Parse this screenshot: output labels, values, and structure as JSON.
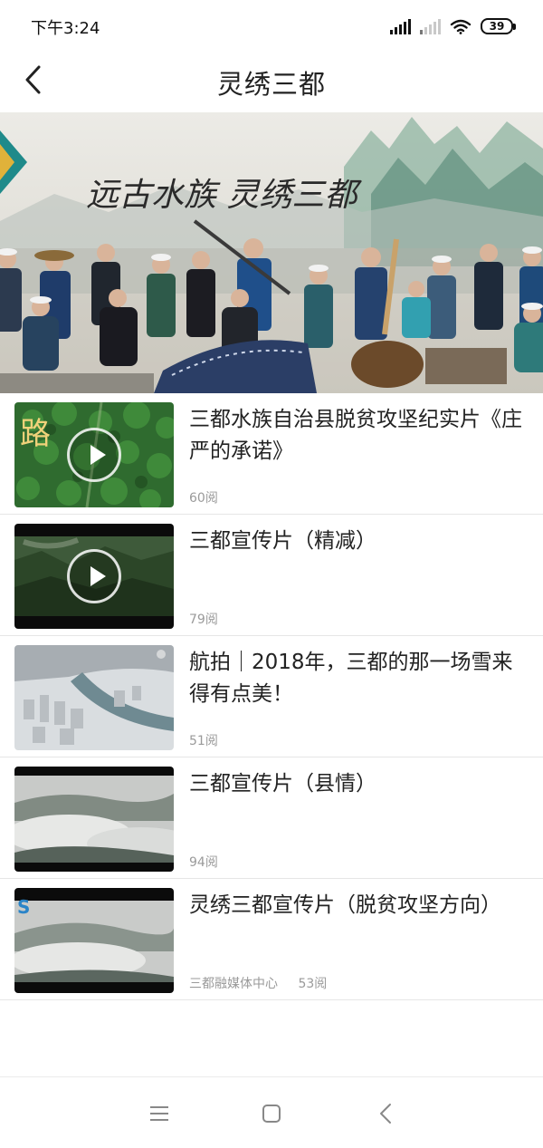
{
  "status_bar": {
    "time": "下午3:24",
    "icons": [
      "signal-icon",
      "signal-weak-icon",
      "wifi-icon",
      "battery-icon"
    ],
    "battery_level": "39"
  },
  "header": {
    "back_icon": "chevron-left-icon",
    "title": "灵绣三都"
  },
  "banner": {
    "caption": "远古水族   灵绣三都",
    "description_is_image": true
  },
  "videos": [
    {
      "title": "三都水族自治县脱贫攻坚纪实片《庄严的承诺》",
      "source": "",
      "reads": "60阅",
      "has_play_icon": true,
      "thumb_text": "路"
    },
    {
      "title": "三都宣传片（精减）",
      "source": "",
      "reads": "79阅",
      "has_play_icon": true
    },
    {
      "title": "航拍｜2018年，三都的那一场雪来得有点美！",
      "source": "",
      "reads": "51阅",
      "has_play_icon": false
    },
    {
      "title": "三都宣传片（县情）",
      "source": "",
      "reads": "94阅",
      "has_play_icon": false
    },
    {
      "title": "灵绣三都宣传片（脱贫攻坚方向）",
      "source": "三都融媒体中心",
      "reads": "53阅",
      "has_play_icon": false
    }
  ],
  "system_nav": {
    "icons": [
      "menu-icon",
      "home-square-icon",
      "back-icon"
    ]
  },
  "colors": {
    "text": "#222222",
    "meta": "#9a9a9a",
    "divider": "#e6e6e6"
  }
}
